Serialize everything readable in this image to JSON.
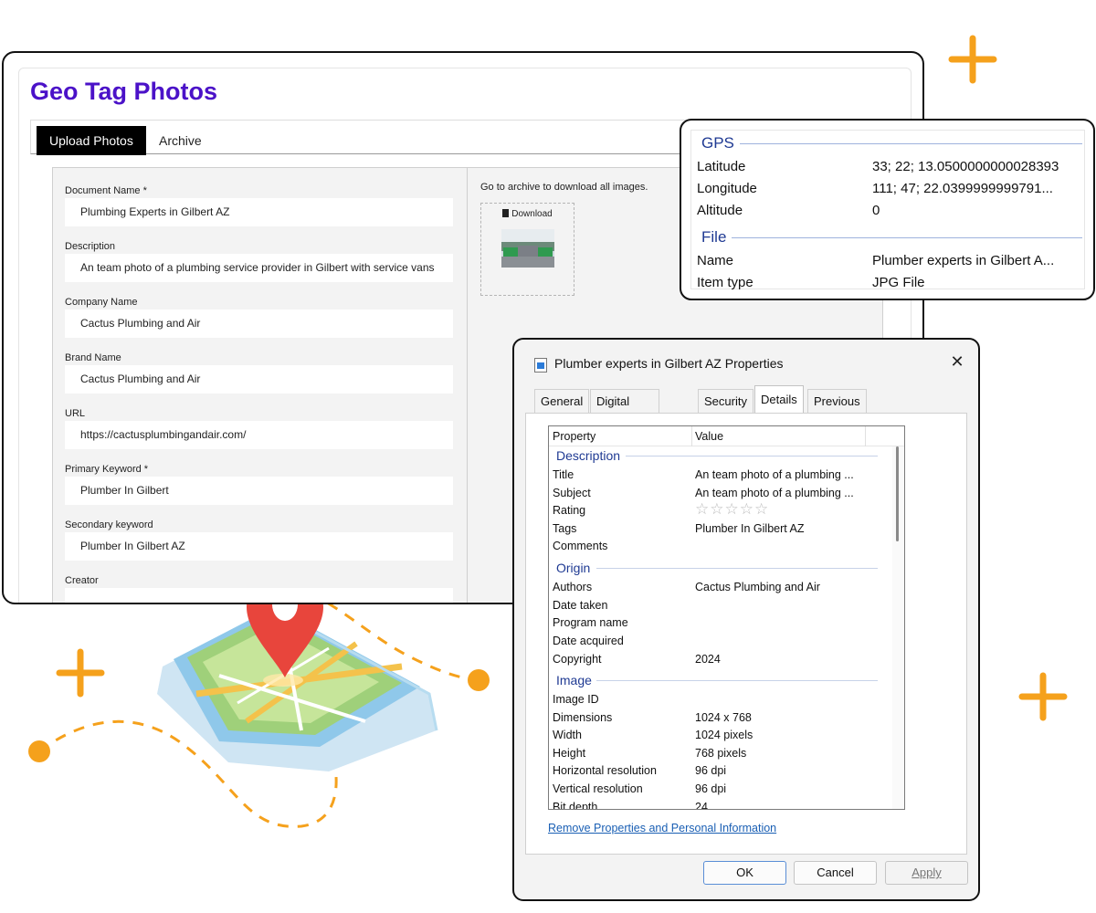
{
  "app": {
    "title": "Geo Tag Photos",
    "tabs": [
      "Upload Photos",
      "Archive"
    ],
    "fields": [
      {
        "label": "Document Name *",
        "value": "Plumbing Experts in Gilbert AZ"
      },
      {
        "label": "Description",
        "value": "An team photo of a plumbing service provider in Gilbert with service vans"
      },
      {
        "label": "Company Name",
        "value": "Cactus Plumbing and Air"
      },
      {
        "label": "Brand Name",
        "value": "Cactus Plumbing and Air"
      },
      {
        "label": "URL",
        "value": "https://cactusplumbingandair.com/"
      },
      {
        "label": "Primary Keyword *",
        "value": "Plumber In Gilbert"
      },
      {
        "label": "Secondary keyword",
        "value": "Plumber In Gilbert AZ"
      },
      {
        "label": "Creator",
        "value": ""
      }
    ],
    "archive_note": "Go to archive to download all images.",
    "download_label": "Download"
  },
  "gps_panel": {
    "gps_heading": "GPS",
    "gps_rows": [
      {
        "key": "Latitude",
        "value": "33; 22; 13.0500000000028393"
      },
      {
        "key": "Longitude",
        "value": "111; 47; 22.0399999999791..."
      },
      {
        "key": "Altitude",
        "value": "0"
      }
    ],
    "file_heading": "File",
    "file_rows": [
      {
        "key": "Name",
        "value": "Plumber experts in Gilbert A..."
      },
      {
        "key": "Item type",
        "value": "JPG File"
      }
    ]
  },
  "dialog": {
    "title": "Plumber experts in Gilbert AZ Properties",
    "close_glyph": "✕",
    "tabs": [
      "General",
      "Digital Signatures",
      "Security",
      "Details",
      "Previous Versions"
    ],
    "active_tab": "Details",
    "col_property": "Property",
    "col_value": "Value",
    "groups": {
      "description": "Description",
      "origin": "Origin",
      "image": "Image"
    },
    "description_rows": [
      {
        "key": "Title",
        "value": "An team photo of a plumbing ..."
      },
      {
        "key": "Subject",
        "value": "An team photo of a plumbing ..."
      },
      {
        "key": "Rating",
        "value": ""
      },
      {
        "key": "Tags",
        "value": "Plumber In Gilbert AZ"
      },
      {
        "key": "Comments",
        "value": ""
      }
    ],
    "rating_stars": "☆☆☆☆☆",
    "origin_rows": [
      {
        "key": "Authors",
        "value": "Cactus Plumbing and Air"
      },
      {
        "key": "Date taken",
        "value": ""
      },
      {
        "key": "Program name",
        "value": ""
      },
      {
        "key": "Date acquired",
        "value": ""
      },
      {
        "key": "Copyright",
        "value": "2024"
      }
    ],
    "image_rows": [
      {
        "key": "Image ID",
        "value": ""
      },
      {
        "key": "Dimensions",
        "value": "1024 x 768"
      },
      {
        "key": "Width",
        "value": "1024 pixels"
      },
      {
        "key": "Height",
        "value": "768 pixels"
      },
      {
        "key": "Horizontal resolution",
        "value": "96 dpi"
      },
      {
        "key": "Vertical resolution",
        "value": "96 dpi"
      },
      {
        "key": "Bit depth",
        "value": "24"
      }
    ],
    "remove_link": "Remove Properties and Personal Information",
    "buttons": {
      "ok": "OK",
      "cancel": "Cancel",
      "apply": "Apply"
    }
  },
  "colors": {
    "brand_purple": "#4b12c8",
    "accent_orange": "#f5a11c",
    "pin_red": "#e8453c",
    "link_blue": "#1a5fb4",
    "group_blue": "#1f3a93"
  }
}
